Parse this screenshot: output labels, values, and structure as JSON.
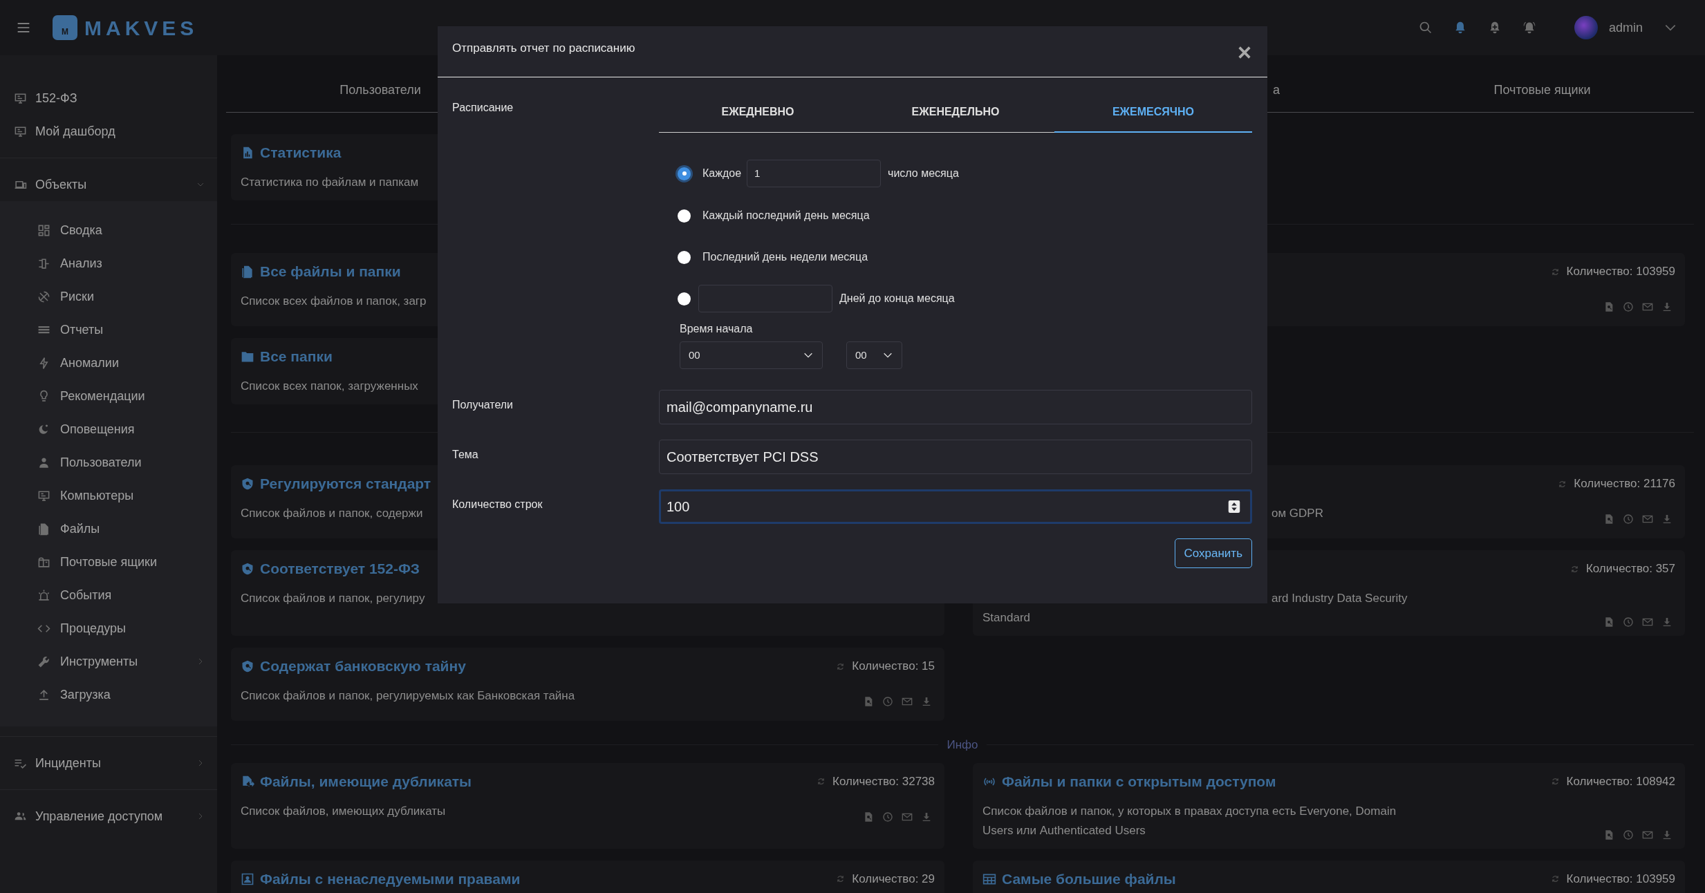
{
  "header": {
    "logo_mark": "M",
    "logo": "MAKVES",
    "user": "admin"
  },
  "sidebar": {
    "top_items": [
      {
        "label": "152-ФЗ"
      },
      {
        "label": "Мой дашборд"
      }
    ],
    "groups": [
      {
        "label": "Объекты",
        "expanded": true,
        "children": [
          {
            "label": "Сводка",
            "has_submenu": false
          },
          {
            "label": "Анализ",
            "has_submenu": false
          },
          {
            "label": "Риски",
            "has_submenu": false
          },
          {
            "label": "Отчеты",
            "has_submenu": false
          },
          {
            "label": "Аномалии",
            "has_submenu": false
          },
          {
            "label": "Рекомендации",
            "has_submenu": false
          },
          {
            "label": "Оповещения",
            "has_submenu": false
          },
          {
            "label": "Пользователи",
            "has_submenu": false
          },
          {
            "label": "Компьютеры",
            "has_submenu": false
          },
          {
            "label": "Файлы",
            "has_submenu": false
          },
          {
            "label": "Почтовые ящики",
            "has_submenu": false
          },
          {
            "label": "События",
            "has_submenu": false
          },
          {
            "label": "Процедуры",
            "has_submenu": false
          },
          {
            "label": "Инструменты",
            "has_submenu": true
          },
          {
            "label": "Загрузка",
            "has_submenu": false
          }
        ]
      },
      {
        "label": "Инциденты",
        "expanded": false
      },
      {
        "label": "Управление доступом",
        "expanded": false
      }
    ]
  },
  "tabs": [
    {
      "label": "Пользователи"
    },
    {
      "label": "а"
    },
    {
      "label": "Почтовые ящики"
    }
  ],
  "sections": [
    {
      "rows": [
        {
          "left": {
            "title": "Статистика",
            "description": [
              "Статистика по файлам и папкам"
            ]
          }
        }
      ]
    },
    {
      "rows": [
        {
          "full": {
            "title": "Все файлы и папки",
            "count": "Количество: 103959",
            "actions": true,
            "description": [
              "Список всех файлов и папок, загр"
            ]
          }
        },
        {
          "left": {
            "title": "Все папки",
            "description": [
              "Список всех папок, загруженных"
            ]
          }
        }
      ]
    },
    {
      "rows": [
        {
          "left": {
            "title": "Регулируются стандарт",
            "description": [
              "Список файлов и папок, содержи"
            ]
          },
          "right": {
            "kind": "covered",
            "count": "Количество: 21176",
            "actions": true,
            "description": [
              "ом GDPR"
            ]
          }
        },
        {
          "left": {
            "title": "Соответствует 152-ФЗ",
            "description": [
              "Список файлов и папок, регулиру"
            ]
          },
          "right": {
            "kind": "covered",
            "count": "Количество: 357",
            "actions": true,
            "description": [
              "ard Industry Data Security",
              "Standard"
            ]
          }
        },
        {
          "left": {
            "title": "Содержат банковскую тайну",
            "count": "Количество: 15",
            "actions": true,
            "description": [
              "Список файлов и папок, регулируемых как Банковская тайна"
            ]
          }
        }
      ]
    },
    {
      "label": "Инфо",
      "rows": [
        {
          "left": {
            "title": "Файлы, имеющие дубликаты",
            "count": "Количество: 32738",
            "actions": true,
            "description": [
              "Список файлов, имеющих дубликаты"
            ]
          },
          "right": {
            "title": "Файлы и папки с открытым доступом",
            "count": "Количество: 108942",
            "actions": true,
            "description": [
              "Список файлов и папок, у которых в правах доступа есть Everyone, Domain",
              "Users или Authenticated Users"
            ]
          }
        },
        {
          "left": {
            "title": "Файлы с ненаследуемыми правами",
            "count": "Количество: 29"
          },
          "right": {
            "title": "Самые большие файлы",
            "count": "Количество: 103959"
          }
        }
      ]
    }
  ],
  "dialog": {
    "title": "Отправлять отчет по расписанию",
    "schedule": {
      "label": "Расписание",
      "tabs": [
        {
          "label": "ЕЖЕДНЕВНО",
          "selected": false
        },
        {
          "label": "ЕЖЕНЕДЕЛЬНО",
          "selected": false
        },
        {
          "label": "ЕЖЕМЕСЯЧНО",
          "selected": true
        }
      ],
      "options": [
        {
          "kind": "input",
          "selected": true,
          "prefix": "Каждое",
          "value": "1",
          "suffix": "число месяца"
        },
        {
          "kind": "text",
          "selected": false,
          "label": "Каждый последний день месяца"
        },
        {
          "kind": "text",
          "selected": false,
          "label": "Последний день недели месяца"
        },
        {
          "kind": "input",
          "selected": false,
          "suffix": "Дней до конца месяца"
        }
      ],
      "time": {
        "label": "Время начала",
        "hours": "00",
        "minutes": "00"
      }
    },
    "fields": [
      {
        "kind": "text",
        "label": "Получатели",
        "value": "mail@companyname.ru",
        "focused": false
      },
      {
        "kind": "text",
        "label": "Тема",
        "value": "Соответствует PCI DSS",
        "focused": false
      },
      {
        "kind": "number",
        "label": "Количество строк",
        "value": "100",
        "focused": true
      }
    ],
    "save_button": "Сохранить"
  }
}
